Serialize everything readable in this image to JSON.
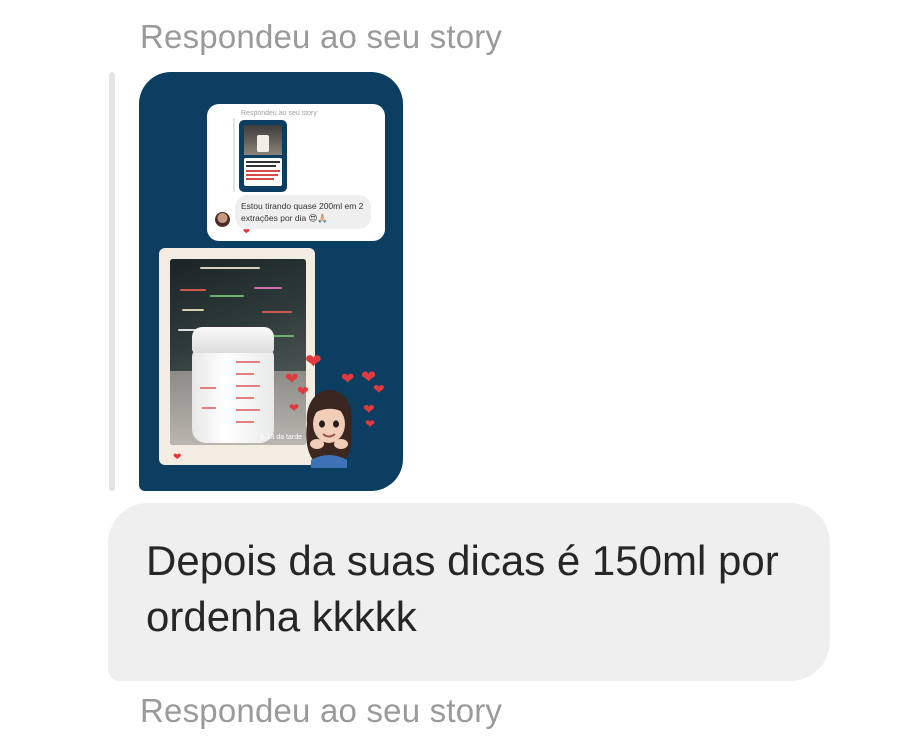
{
  "thread": {
    "reply_label_top": "Respondeu ao seu story",
    "reply_label_bottom": "Respondeu ao seu story"
  },
  "story": {
    "inner_label": "Respondeu ao seu story",
    "inner_message": "Estou tirando quase 200ml em 2 extrações por dia 😍🙏🏼",
    "photo_time": "6:13 da tarde",
    "heart_icon": "heart-icon"
  },
  "message": {
    "text": "Depois da suas dicas é 150ml por ordenha kkkkk"
  },
  "colors": {
    "story_background": "#0c3e62",
    "bubble": "#efefef",
    "label": "#9a9a9a",
    "heart": "#e0393e"
  }
}
